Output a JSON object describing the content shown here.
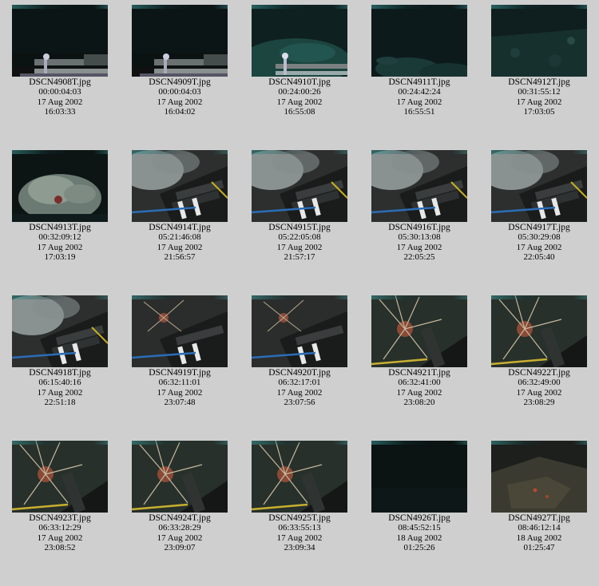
{
  "thumbnails": [
    {
      "filename": "DSCN4908T.jpg",
      "elapsed": "00:00:04:03",
      "date": "17 Aug 2002",
      "time": "16:03:33",
      "scene": "dark-equipment"
    },
    {
      "filename": "DSCN4909T.jpg",
      "elapsed": "00:00:04:03",
      "date": "17 Aug 2002",
      "time": "16:04:02",
      "scene": "dark-equipment"
    },
    {
      "filename": "DSCN4910T.jpg",
      "elapsed": "00:24:00:26",
      "date": "17 Aug 2002",
      "time": "16:55:08",
      "scene": "seafloor-equipment"
    },
    {
      "filename": "DSCN4911T.jpg",
      "elapsed": "00:24:42:24",
      "date": "17 Aug 2002",
      "time": "16:55:51",
      "scene": "seafloor-rocks"
    },
    {
      "filename": "DSCN4912T.jpg",
      "elapsed": "00:31:55:12",
      "date": "17 Aug 2002",
      "time": "17:03:05",
      "scene": "rocky-slope"
    },
    {
      "filename": "DSCN4913T.jpg",
      "elapsed": "00:32:09:12",
      "date": "17 Aug 2002",
      "time": "17:03:19",
      "scene": "coral-mound"
    },
    {
      "filename": "DSCN4914T.jpg",
      "elapsed": "05:21:46:08",
      "date": "17 Aug 2002",
      "time": "21:56:57",
      "scene": "vent-sampler"
    },
    {
      "filename": "DSCN4915T.jpg",
      "elapsed": "05:22:05:08",
      "date": "17 Aug 2002",
      "time": "21:57:17",
      "scene": "vent-sampler"
    },
    {
      "filename": "DSCN4916T.jpg",
      "elapsed": "05:30:13:08",
      "date": "17 Aug 2002",
      "time": "22:05:25",
      "scene": "vent-sampler"
    },
    {
      "filename": "DSCN4917T.jpg",
      "elapsed": "05:30:29:08",
      "date": "17 Aug 2002",
      "time": "22:05:40",
      "scene": "vent-sampler"
    },
    {
      "filename": "DSCN4918T.jpg",
      "elapsed": "06:15:40:16",
      "date": "17 Aug 2002",
      "time": "22:51:18",
      "scene": "vent-sampler"
    },
    {
      "filename": "DSCN4919T.jpg",
      "elapsed": "06:32:11:01",
      "date": "17 Aug 2002",
      "time": "23:07:48",
      "scene": "crab-sampler"
    },
    {
      "filename": "DSCN4920T.jpg",
      "elapsed": "06:32:17:01",
      "date": "17 Aug 2002",
      "time": "23:07:56",
      "scene": "crab-sampler"
    },
    {
      "filename": "DSCN4921T.jpg",
      "elapsed": "06:32:41:00",
      "date": "17 Aug 2002",
      "time": "23:08:20",
      "scene": "crab-closeup"
    },
    {
      "filename": "DSCN4922T.jpg",
      "elapsed": "06:32:49:00",
      "date": "17 Aug 2002",
      "time": "23:08:29",
      "scene": "crab-closeup"
    },
    {
      "filename": "DSCN4923T.jpg",
      "elapsed": "06:33:12:29",
      "date": "17 Aug 2002",
      "time": "23:08:52",
      "scene": "crab-closeup"
    },
    {
      "filename": "DSCN4924T.jpg",
      "elapsed": "06:33:28:29",
      "date": "17 Aug 2002",
      "time": "23:09:07",
      "scene": "crab-closeup"
    },
    {
      "filename": "DSCN4925T.jpg",
      "elapsed": "06:33:55:13",
      "date": "17 Aug 2002",
      "time": "23:09:34",
      "scene": "crab-closeup"
    },
    {
      "filename": "DSCN4926T.jpg",
      "elapsed": "08:45:52:15",
      "date": "18 Aug 2002",
      "time": "01:25:26",
      "scene": "dark-water"
    },
    {
      "filename": "DSCN4927T.jpg",
      "elapsed": "08:46:12:14",
      "date": "18 Aug 2002",
      "time": "01:25:47",
      "scene": "rock-wall"
    }
  ]
}
